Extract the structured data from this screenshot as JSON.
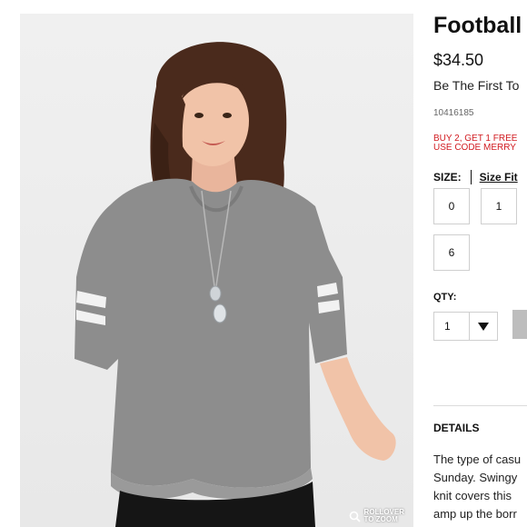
{
  "product": {
    "title": "Football",
    "price": "$34.50",
    "review_prompt": "Be The First To",
    "sku": "10416185",
    "promo_line1": "BUY 2, GET 1 FREE",
    "promo_line2": "USE CODE MERRY",
    "image_alt": "Model wearing a heather gray football tee with white sleeve stripes and a pendant necklace"
  },
  "zoom_hint": {
    "line1": "ROLLOVER",
    "line2": "TO ZOOM",
    "icon": "magnifier-icon"
  },
  "size": {
    "label": "SIZE:",
    "fit_link": "Size Fit",
    "options": [
      "0",
      "1",
      "",
      "6"
    ]
  },
  "quantity": {
    "label": "QTY:",
    "value": "1",
    "icon": "chevron-down-icon"
  },
  "details": {
    "heading": "DETAILS",
    "lines": [
      "The type of casu",
      "Sunday. Swingy",
      "knit covers this",
      "amp up the borr"
    ]
  },
  "colors": {
    "promo": "#d11b20",
    "shirt": "#8d8d8d",
    "stripe": "#f2f2f2",
    "hair": "#4a2a1c",
    "pants": "#151515",
    "button": "#bdbdbd"
  }
}
